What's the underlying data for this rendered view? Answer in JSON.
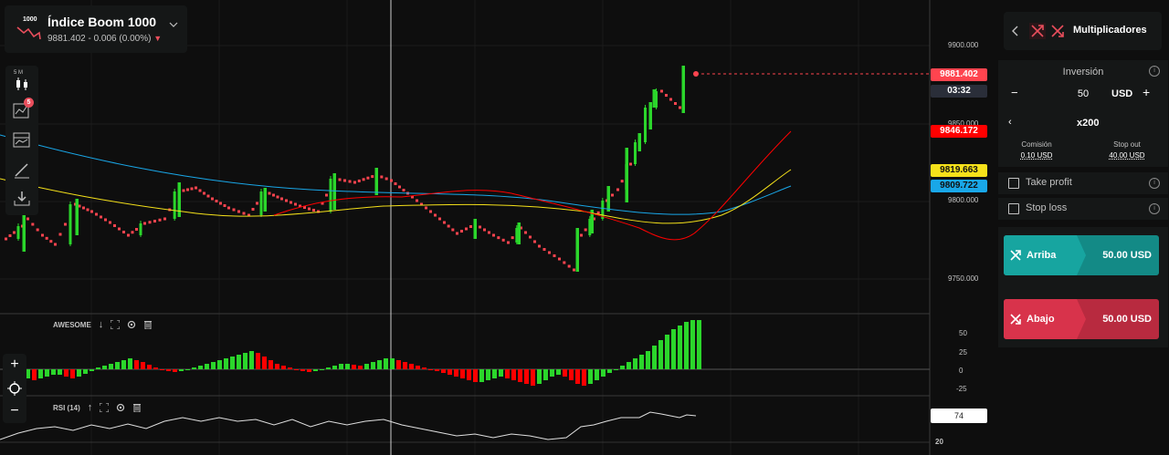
{
  "symbol": {
    "icon_label": "1000",
    "name": "Índice Boom 1000",
    "quote": "9881.402 - 0.006 (0.00%)",
    "trend_icon": "triangle-down-icon"
  },
  "toolbar": {
    "interval_label": "5 M",
    "indicator_badge": "5",
    "tools": [
      "candles-icon",
      "indicators-icon",
      "templates-icon",
      "drawing-icon",
      "download-icon"
    ]
  },
  "price_axis": {
    "labels": [
      "9900.000",
      "9850.000",
      "9800.000",
      "9750.000"
    ],
    "current_price": "9881.402",
    "countdown": "03:32",
    "ma_tags": [
      {
        "value": "9846.172",
        "color": "#ff0000"
      },
      {
        "value": "9819.663",
        "color": "#f5e11a"
      },
      {
        "value": "9809.722",
        "color": "#19a7e8"
      }
    ]
  },
  "awesome": {
    "title": "AWESOME",
    "arrow": "↓",
    "axis": [
      "50",
      "25",
      "0",
      "-25"
    ]
  },
  "rsi": {
    "title": "RSI (14)",
    "arrow": "↑",
    "value": "74",
    "axis_bottom": "20"
  },
  "zoom": {
    "plus": "+",
    "minus": "−"
  },
  "panel": {
    "title": "Multiplicadores",
    "investment_label": "Inversión",
    "stake": "50",
    "currency": "USD",
    "minus": "−",
    "plus": "+",
    "multiplier": "x200",
    "commission_label": "Comisión",
    "commission_value": "0.10 USD",
    "stopout_label": "Stop out",
    "stopout_value": "40.00 USD",
    "take_profit": "Take profit",
    "stop_loss": "Stop loss",
    "up_label": "Arriba",
    "up_amount": "50.00 USD",
    "down_label": "Abajo",
    "down_amount": "50.00 USD",
    "colors": {
      "up": "#17a5a0",
      "down": "#d8334b"
    }
  }
}
